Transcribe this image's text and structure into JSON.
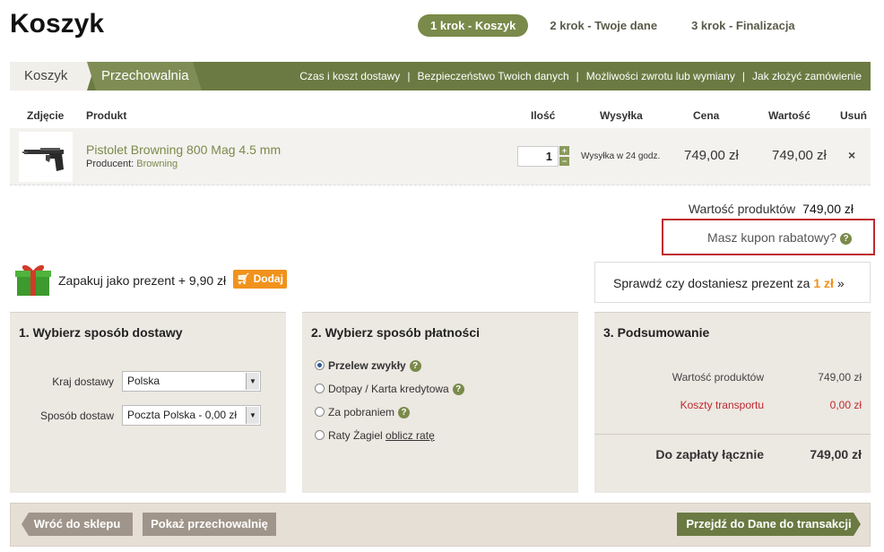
{
  "page": {
    "title": "Koszyk"
  },
  "steps": [
    {
      "label": "1 krok - Koszyk",
      "active": true
    },
    {
      "label": "2 krok - Twoje dane",
      "active": false
    },
    {
      "label": "3 krok - Finalizacja",
      "active": false
    }
  ],
  "tabs": {
    "cart": "Koszyk",
    "storage": "Przechowalnia"
  },
  "info_links": [
    "Czas i koszt dostawy",
    "Bezpieczeństwo Twoich danych",
    "Możliwości zwrotu lub wymiany",
    "Jak złożyć zamówienie"
  ],
  "table": {
    "headers": {
      "photo": "Zdjęcie",
      "product": "Produkt",
      "qty": "Ilość",
      "shipping": "Wysyłka",
      "price": "Cena",
      "value": "Wartość",
      "remove": "Usuń"
    },
    "rows": [
      {
        "name": "Pistolet Browning 800 Mag 4.5 mm",
        "maker_label": "Producent:",
        "maker": "Browning",
        "qty": "1",
        "shipping": "Wysyłka w 24 godz.",
        "price": "749,00 zł",
        "value": "749,00 zł",
        "remove": "×"
      }
    ]
  },
  "products_total": {
    "label": "Wartość produktów",
    "value": "749,00 zł"
  },
  "coupon": {
    "label": "Masz kupon rabatowy?"
  },
  "gift_wrap": {
    "label": "Zapakuj jako prezent + 9,90 zł",
    "button": "Dodaj"
  },
  "gift_check": {
    "prefix": "Sprawdź czy dostaniesz prezent za",
    "amount": "1 zł",
    "suffix": "»"
  },
  "delivery": {
    "title": "1. Wybierz sposób dostawy",
    "country_label": "Kraj dostawy",
    "country_value": "Polska",
    "method_label": "Sposób dostaw",
    "method_value": "Poczta Polska - 0,00 zł"
  },
  "payment": {
    "title": "2. Wybierz sposób płatności",
    "options": [
      {
        "label": "Przelew zwykły",
        "selected": true,
        "help": true
      },
      {
        "label": "Dotpay / Karta kredytowa",
        "selected": false,
        "help": true
      },
      {
        "label": "Za pobraniem",
        "selected": false,
        "help": true
      },
      {
        "label": "Raty Żagiel",
        "link": "oblicz ratę",
        "selected": false,
        "help": false
      }
    ]
  },
  "summary": {
    "title": "3. Podsumowanie",
    "products_label": "Wartość produktów",
    "products_value": "749,00 zł",
    "transport_label": "Koszty transportu",
    "transport_value": "0,00 zł",
    "total_label": "Do zapłaty łącznie",
    "total_value": "749,00 zł"
  },
  "buttons": {
    "back": "Wróć do sklepu",
    "show_storage": "Pokaż przechowalnię",
    "next": "Przejdź do Dane do transakcji"
  },
  "colors": {
    "accent": "#6b7a42",
    "orange": "#f0921d",
    "highlight": "#c0282e"
  },
  "icons": {
    "help": "question-icon",
    "cart": "cart-icon",
    "gift": "gift-icon",
    "remove": "close-icon"
  }
}
